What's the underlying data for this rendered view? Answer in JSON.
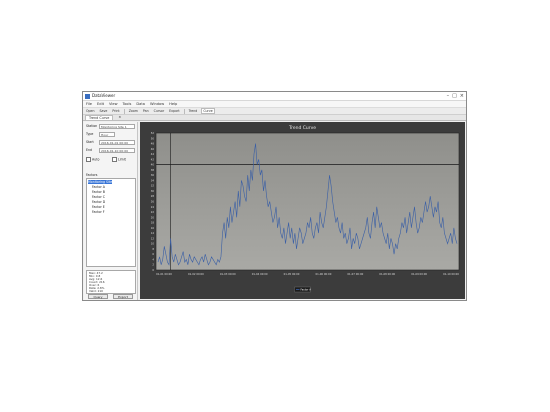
{
  "window": {
    "title": "DataViewer",
    "controls": [
      "–",
      "□",
      "×"
    ]
  },
  "menu": [
    "File",
    "Edit",
    "View",
    "Tools",
    "Data",
    "Window",
    "Help"
  ],
  "toolbar": [
    "Open",
    "Save",
    "Print",
    "Zoom",
    "Pan",
    "Cursor",
    "Export",
    "Trend",
    "Curve"
  ],
  "tabs": [
    {
      "label": "Trend Curve",
      "active": true
    },
    {
      "label": "×",
      "active": false
    }
  ],
  "sidebar": {
    "fields": [
      {
        "label": "Station",
        "value": "Monitoring Site 1"
      },
      {
        "label": "Type",
        "value": "Hour"
      },
      {
        "label": "Start",
        "value": "2016-01-01 00:00"
      },
      {
        "label": "End",
        "value": "2016-01-10 00:00"
      }
    ],
    "checkbox_left": "Auto",
    "checkbox_right": "Limit",
    "group_label": "Factors",
    "tree": {
      "root": "Monitoring Site",
      "items": [
        "Factor A",
        "Factor B",
        "Factor C",
        "Factor D",
        "Factor E",
        "Factor F"
      ]
    },
    "props": [
      "Max: 47.2",
      "Min: 0.8",
      "Avg: 12.6",
      "Count: 216",
      "Over: 6",
      "Rate: 2.8%",
      "Valid: 210"
    ],
    "buttons": [
      "Query",
      "Export"
    ]
  },
  "chart_data": {
    "type": "line",
    "title": "Trend Curve",
    "xlabel": "",
    "ylabel": "",
    "background": "#a9a9a5",
    "line_color": "#3a5fa6",
    "threshold_value": 40,
    "cursor_x_index": 8,
    "ylim": [
      0,
      52
    ],
    "ytick_step": 2,
    "xtick_labels": [
      "01-01 00:00",
      "01-02 00:00",
      "01-03 00:00",
      "01-04 00:00",
      "01-05 00:00",
      "01-06 00:00",
      "01-07 00:00",
      "01-08 00:00",
      "01-09 00:00",
      "01-10 00:00"
    ],
    "legend": [
      "Factor A"
    ],
    "series": [
      {
        "name": "Factor A",
        "values": [
          3,
          5,
          2,
          4,
          9,
          6,
          3,
          2,
          12,
          5,
          3,
          6,
          4,
          2,
          3,
          5,
          7,
          3,
          4,
          2,
          6,
          4,
          3,
          5,
          4,
          3,
          2,
          4,
          5,
          3,
          6,
          4,
          2,
          3,
          5,
          4,
          3,
          2,
          4,
          3,
          5,
          14,
          18,
          12,
          20,
          16,
          24,
          18,
          22,
          26,
          20,
          30,
          24,
          34,
          32,
          28,
          26,
          36,
          30,
          38,
          34,
          44,
          48,
          40,
          42,
          36,
          38,
          30,
          34,
          28,
          24,
          26,
          22,
          18,
          20,
          24,
          16,
          20,
          14,
          12,
          16,
          10,
          14,
          18,
          12,
          16,
          10,
          14,
          8,
          12,
          16,
          14,
          10,
          12,
          14,
          18,
          16,
          20,
          14,
          12,
          16,
          18,
          14,
          22,
          18,
          16,
          20,
          24,
          30,
          36,
          32,
          26,
          22,
          18,
          20,
          16,
          14,
          18,
          12,
          14,
          10,
          12,
          16,
          8,
          12,
          10,
          14,
          12,
          8,
          10,
          12,
          14,
          16,
          20,
          14,
          12,
          18,
          22,
          16,
          24,
          20,
          16,
          18,
          14,
          12,
          10,
          14,
          8,
          12,
          10,
          6,
          10,
          8,
          12,
          14,
          18,
          16,
          20,
          14,
          18,
          22,
          16,
          20,
          24,
          18,
          14,
          16,
          20,
          18,
          22,
          26,
          22,
          24,
          28,
          24,
          20,
          24,
          22,
          26,
          18,
          16,
          20,
          14,
          12,
          10,
          12,
          14,
          10,
          16,
          12,
          10
        ]
      }
    ]
  }
}
